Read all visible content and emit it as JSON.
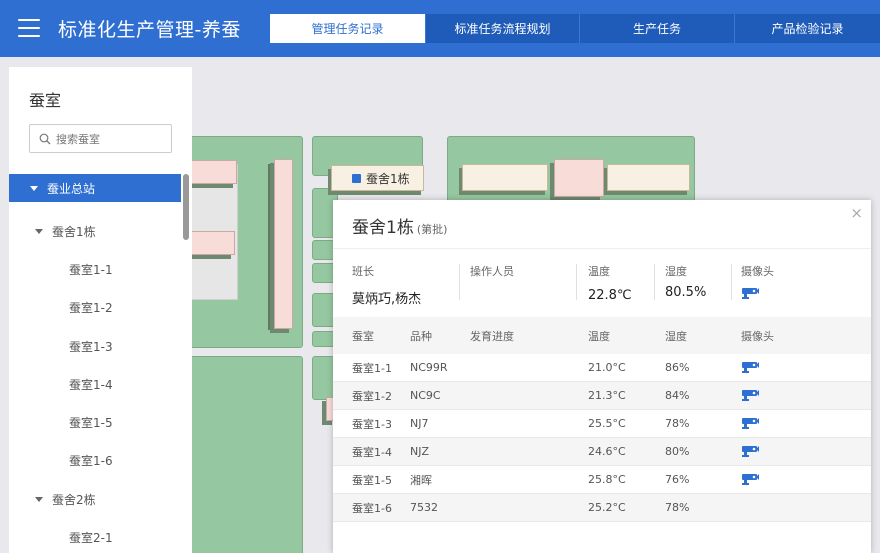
{
  "app": {
    "title": "标准化生产管理-养蚕"
  },
  "tabs": [
    {
      "label": "管理任务记录",
      "active": true
    },
    {
      "label": "标准任务流程规划",
      "active": false
    },
    {
      "label": "生产任务",
      "active": false
    },
    {
      "label": "产品检验记录",
      "active": false
    }
  ],
  "sidebar": {
    "title": "蚕室",
    "search_placeholder": "搜索蚕室",
    "tree": [
      {
        "label": "蚕业总站",
        "level": 0,
        "selected": true
      },
      {
        "label": "蚕舍1栋",
        "level": 1
      },
      {
        "label": "蚕室1-1",
        "level": 2
      },
      {
        "label": "蚕室1-2",
        "level": 2
      },
      {
        "label": "蚕室1-3",
        "level": 2
      },
      {
        "label": "蚕室1-4",
        "level": 2
      },
      {
        "label": "蚕室1-5",
        "level": 2
      },
      {
        "label": "蚕室1-6",
        "level": 2
      },
      {
        "label": "蚕舍2栋",
        "level": 1
      },
      {
        "label": "蚕室2-1",
        "level": 2
      }
    ]
  },
  "map": {
    "building_label": "蚕舍1栋"
  },
  "card": {
    "title": "蚕舍1栋",
    "subtitle": "(第批)",
    "info": {
      "leader_label": "班长",
      "leader_value": "莫炳巧,杨杰",
      "operator_label": "操作人员",
      "operator_value": "",
      "temp_label": "温度",
      "temp_value": "22.8℃",
      "humidity_label": "湿度",
      "humidity_value": "80.5%",
      "camera_label": "摄像头"
    },
    "table": {
      "headers": [
        "蚕室",
        "品种",
        "发育进度",
        "温度",
        "湿度",
        "摄像头"
      ],
      "rows": [
        {
          "room": "蚕室1-1",
          "variety": "NC99R",
          "progress": "",
          "temp": "21.0°C",
          "humidity": "86%",
          "camera": true
        },
        {
          "room": "蚕室1-2",
          "variety": "NC9C",
          "progress": "",
          "temp": "21.3°C",
          "humidity": "84%",
          "camera": true
        },
        {
          "room": "蚕室1-3",
          "variety": "NJ7",
          "progress": "",
          "temp": "25.5°C",
          "humidity": "78%",
          "camera": true
        },
        {
          "room": "蚕室1-4",
          "variety": "NJZ",
          "progress": "",
          "temp": "24.6°C",
          "humidity": "80%",
          "camera": true
        },
        {
          "room": "蚕室1-5",
          "variety": "湘晖",
          "progress": "",
          "temp": "25.8°C",
          "humidity": "76%",
          "camera": true
        },
        {
          "room": "蚕室1-6",
          "variety": "7532",
          "progress": "",
          "temp": "25.2°C",
          "humidity": "78%",
          "camera": false
        }
      ]
    }
  },
  "colors": {
    "primary": "#2f6fd1",
    "building": "#95c8a0",
    "room": "#f7dcd8"
  }
}
